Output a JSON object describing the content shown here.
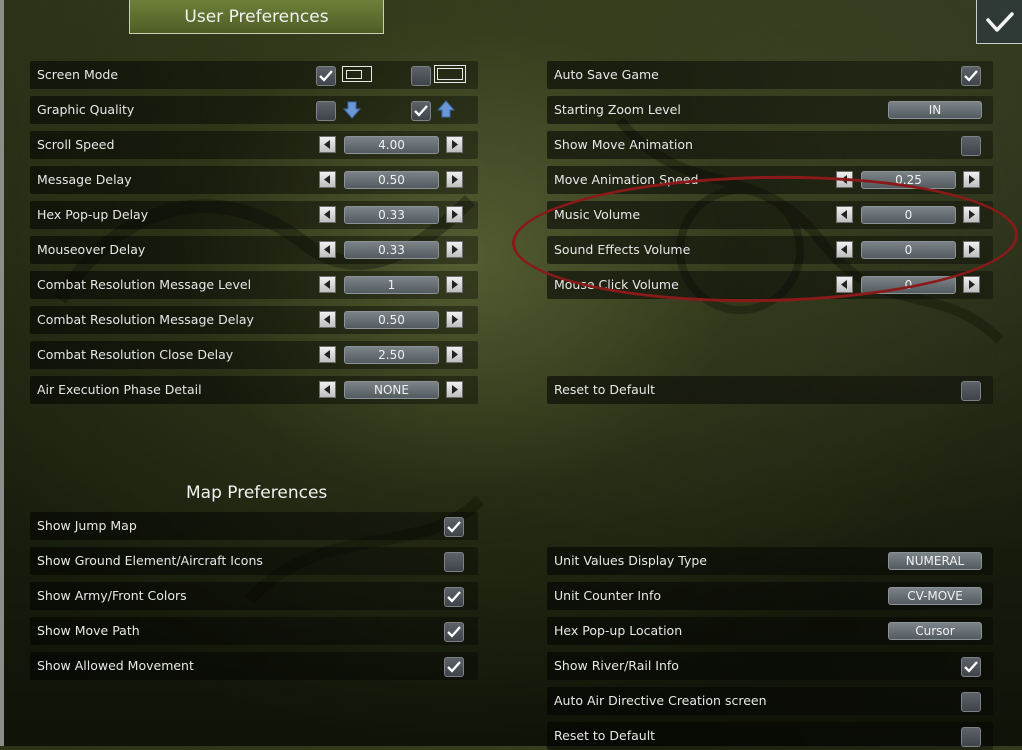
{
  "window": {
    "title": "User Preferences"
  },
  "sections": {
    "map_title": "Map Preferences"
  },
  "left_rows": [
    {
      "label": "Screen Mode"
    },
    {
      "label": "Graphic Quality"
    },
    {
      "label": "Scroll Speed",
      "value": "4.00"
    },
    {
      "label": "Message Delay",
      "value": "0.50"
    },
    {
      "label": "Hex Pop-up Delay",
      "value": "0.33"
    },
    {
      "label": "Mouseover Delay",
      "value": "0.33"
    },
    {
      "label": "Combat Resolution Message Level",
      "value": "1"
    },
    {
      "label": "Combat Resolution Message Delay",
      "value": "0.50"
    },
    {
      "label": "Combat Resolution Close Delay",
      "value": "2.50"
    },
    {
      "label": "Air Execution Phase Detail",
      "value": "NONE"
    }
  ],
  "right_rows": [
    {
      "label": "Auto Save Game",
      "checked": true
    },
    {
      "label": "Starting Zoom Level",
      "button": "IN"
    },
    {
      "label": "Show Move Animation",
      "checked": false
    },
    {
      "label": "Move Animation Speed",
      "value": "0.25"
    },
    {
      "label": "Music Volume",
      "value": "0"
    },
    {
      "label": "Sound Effects Volume",
      "value": "0"
    },
    {
      "label": "Mouse Click Volume",
      "value": "0"
    },
    {
      "label": "Reset to Default",
      "checked": false
    }
  ],
  "map_left_rows": [
    {
      "label": "Show Jump Map",
      "checked": true
    },
    {
      "label": "Show Ground Element/Aircraft Icons",
      "checked": false
    },
    {
      "label": "Show Army/Front Colors",
      "checked": true
    },
    {
      "label": "Show Move Path",
      "checked": true
    },
    {
      "label": "Show Allowed Movement",
      "checked": true
    }
  ],
  "map_right_rows": [
    {
      "label": "Unit Values Display Type",
      "button": "NUMERAL"
    },
    {
      "label": "Unit Counter Info",
      "button": "CV-MOVE"
    },
    {
      "label": "Hex Pop-up Location",
      "button": "Cursor"
    },
    {
      "label": "Show River/Rail Info",
      "checked": true
    },
    {
      "label": "Auto Air Directive Creation screen",
      "checked": false
    },
    {
      "label": "Reset to Default",
      "checked": false
    }
  ],
  "icons": {
    "check": "checkmark-icon",
    "left": "arrow-left-icon",
    "right": "arrow-right-icon",
    "quality_low": "arrow-down-icon",
    "quality_high": "arrow-up-icon",
    "close": "check-close-icon"
  },
  "colors": {
    "accent": "#5b6b2c",
    "highlight_oval": "#8a1a1a"
  }
}
